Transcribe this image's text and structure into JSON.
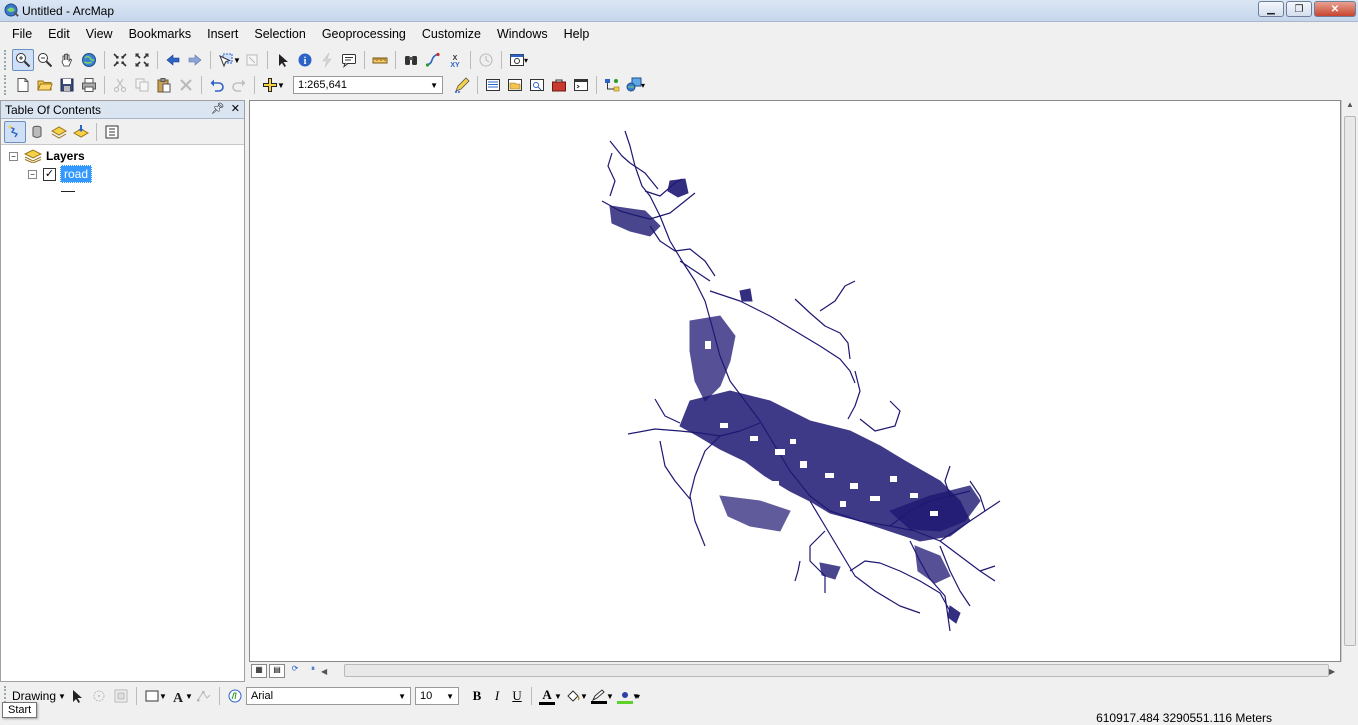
{
  "window": {
    "title": "Untitled - ArcMap"
  },
  "menu": [
    "File",
    "Edit",
    "View",
    "Bookmarks",
    "Insert",
    "Selection",
    "Geoprocessing",
    "Customize",
    "Windows",
    "Help"
  ],
  "standard_toolbar": {
    "scale": "1:265,641"
  },
  "toc": {
    "title": "Table Of Contents",
    "root_label": "Layers",
    "layer": {
      "name": "road",
      "checked": true
    }
  },
  "drawing_toolbar": {
    "label": "Drawing",
    "font": "Arial",
    "font_size": "10",
    "bold": "B",
    "italic": "I",
    "underline": "U",
    "font_color_glyph": "A"
  },
  "status": {
    "start_tooltip": "Start",
    "coordinates": "610917.484  3290551.116 Meters"
  },
  "colors": {
    "road_stroke": "#1e1873",
    "selection_blue": "#3399ff"
  }
}
